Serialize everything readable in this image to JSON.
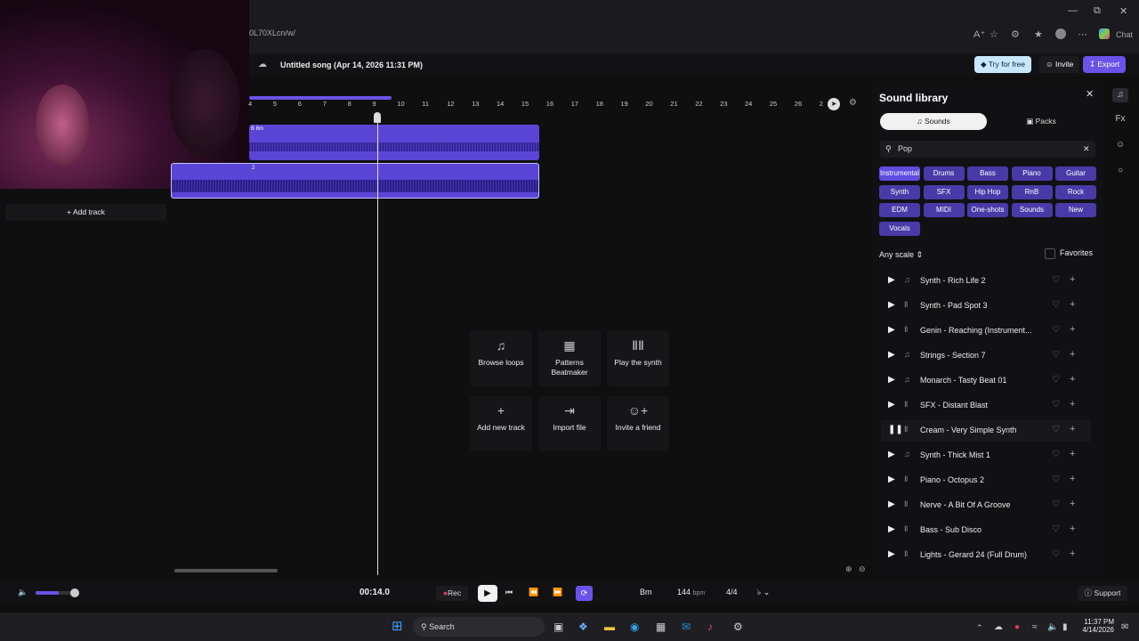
{
  "browser": {
    "url_fragment": "0L70XLcn/w/",
    "chat_label": "Chat"
  },
  "header": {
    "song_title": "Untitled song (Apr 14, 2026 11:31 PM)",
    "try_free": "Try for free",
    "invite": "Invite",
    "export": "Export"
  },
  "timeline": {
    "ruler_ticks": [
      "4",
      "5",
      "6",
      "7",
      "8",
      "9",
      "10",
      "11",
      "12",
      "13",
      "14",
      "15",
      "16",
      "17",
      "18",
      "19",
      "20",
      "21",
      "22",
      "23",
      "24",
      "25",
      "26",
      "2"
    ],
    "clip1_label": "B 8m",
    "clip2_label": "2",
    "add_track": "Add track"
  },
  "actions": [
    {
      "label": "Browse loops",
      "icon": "music-note-icon"
    },
    {
      "label": "Patterns Beatmaker",
      "icon": "grid-pattern-icon"
    },
    {
      "label": "Play the synth",
      "icon": "piano-icon"
    },
    {
      "label": "Add new track",
      "icon": "plus-icon"
    },
    {
      "label": "Import file",
      "icon": "import-icon"
    },
    {
      "label": "Invite a friend",
      "icon": "add-person-icon"
    }
  ],
  "library": {
    "title": "Sound library",
    "tab_sounds": "Sounds",
    "tab_packs": "Packs",
    "search_value": "Pop",
    "categories": [
      "Instrumental",
      "Drums",
      "Bass",
      "Piano",
      "Guitar",
      "Synth",
      "SFX",
      "Hip Hop",
      "RnB",
      "Rock",
      "EDM",
      "MIDI",
      "One-shots",
      "Sounds",
      "New",
      "Vocals"
    ],
    "scale": "Any scale",
    "favorites": "Favorites",
    "items": [
      {
        "name": "Synth - Rich Life 2",
        "kind": "midi",
        "playing": false
      },
      {
        "name": "Synth - Pad Spot 3",
        "kind": "audio",
        "playing": false
      },
      {
        "name": "Genin - Reaching (Instrument...",
        "kind": "audio",
        "playing": false
      },
      {
        "name": "Strings - Section 7",
        "kind": "midi",
        "playing": false
      },
      {
        "name": "Monarch - Tasty Beat 01",
        "kind": "midi",
        "playing": false
      },
      {
        "name": "SFX - Distant Blast",
        "kind": "audio",
        "playing": false
      },
      {
        "name": "Cream - Very Simple Synth",
        "kind": "audio",
        "playing": true
      },
      {
        "name": "Synth - Thick Mist 1",
        "kind": "midi",
        "playing": false
      },
      {
        "name": "Piano - Octopus 2",
        "kind": "audio",
        "playing": false
      },
      {
        "name": "Nerve - A Bit Of A Groove",
        "kind": "audio",
        "playing": false
      },
      {
        "name": "Bass - Sub Disco",
        "kind": "audio",
        "playing": false
      },
      {
        "name": "Lights - Gerard 24 (Full Drum)",
        "kind": "audio",
        "playing": false
      }
    ]
  },
  "transport": {
    "time": "00:14.0",
    "rec": "Rec",
    "key": "Bm",
    "bpm": "144",
    "bpm_unit": "bpm",
    "signature": "4/4",
    "support": "Support",
    "volume_fraction": 0.55
  },
  "taskbar": {
    "search": "Search",
    "time": "11:37 PM",
    "date": "4/14/2026"
  },
  "colors": {
    "accent": "#6b52e8",
    "clip": "#5b45d6",
    "chip": "#4a3aa8"
  }
}
